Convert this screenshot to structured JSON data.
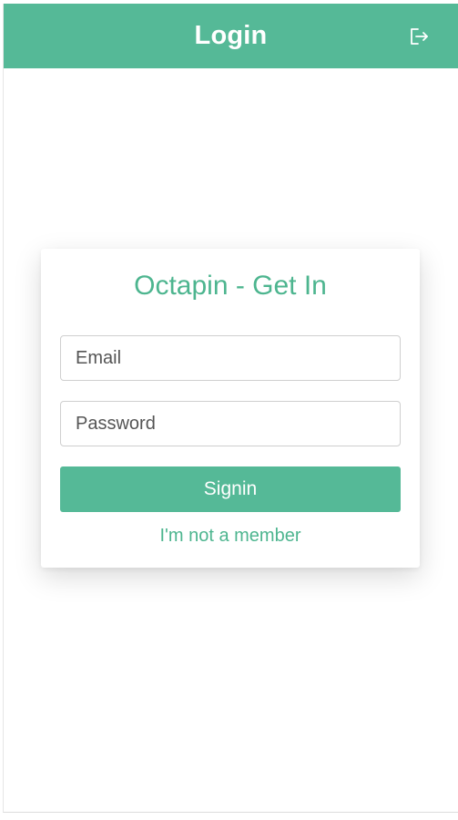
{
  "header": {
    "title": "Login",
    "logout_icon": "logout-icon"
  },
  "login_card": {
    "title": "Octapin - Get In",
    "email_placeholder": "Email",
    "email_value": "",
    "password_placeholder": "Password",
    "password_value": "",
    "signin_label": "Signin",
    "member_link": "I'm not a member"
  },
  "colors": {
    "brand": "#55b997",
    "brand_text": "#4db58f"
  }
}
